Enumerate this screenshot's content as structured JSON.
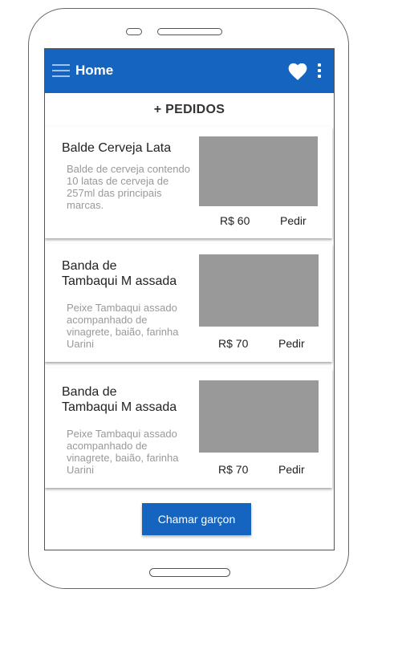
{
  "appbar": {
    "title": "Home",
    "icons": [
      "menu-icon",
      "heart-icon",
      "more-vert-icon"
    ],
    "color": "#1565c0"
  },
  "subheader": {
    "label": "+ PEDIDOS"
  },
  "items": [
    {
      "title": "Balde Cerveja Lata",
      "description": "Balde de cerveja contendo 10 latas de cerveja de 257ml das principais marcas.",
      "price": "R$ 60",
      "order_label": "Pedir"
    },
    {
      "title": "Banda de\nTambaqui M assada",
      "description": "Peixe Tambaqui assado acompanhado de vinagrete, baião, farinha Uarini",
      "price": "R$ 70",
      "order_label": "Pedir"
    },
    {
      "title": "Banda de\nTambaqui M assada",
      "description": "Peixe Tambaqui assado acompanhado de vinagrete, baião, farinha Uarini",
      "price": "R$ 70",
      "order_label": "Pedir"
    }
  ],
  "call_waiter": {
    "label": "Chamar garçon"
  }
}
